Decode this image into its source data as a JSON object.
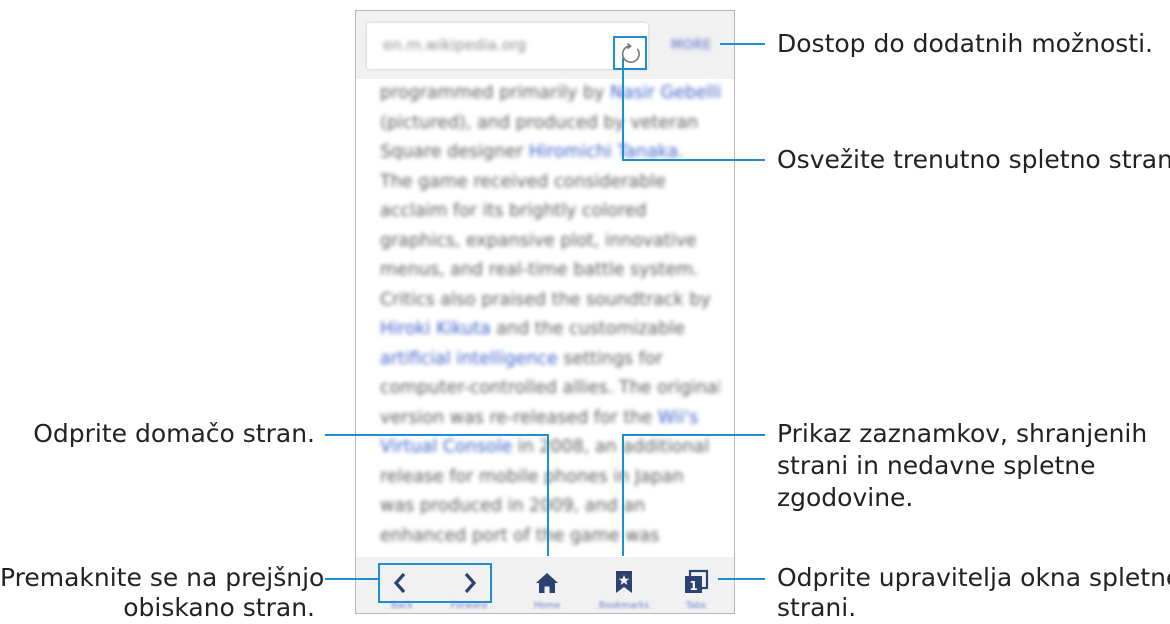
{
  "browser": {
    "url": "en.m.wikipedia.org",
    "more_label": "MORE",
    "content_lines": [
      [
        {
          "t": "programmed primarily by "
        },
        {
          "t": "Nasir Gebelli",
          "link": true
        }
      ],
      [
        {
          "t": "(pictured), and produced by veteran"
        }
      ],
      [
        {
          "t": "Square designer "
        },
        {
          "t": "Hiromichi Tanaka",
          "link": true
        },
        {
          "t": "."
        }
      ],
      [
        {
          "t": "The game received considerable"
        }
      ],
      [
        {
          "t": "acclaim for its brightly colored"
        }
      ],
      [
        {
          "t": "graphics, expansive plot, innovative"
        }
      ],
      [
        {
          "t": "menus, and real-time battle system."
        }
      ],
      [
        {
          "t": "Critics also praised the soundtrack by"
        }
      ],
      [
        {
          "t": "Hiroki Kikuta",
          "link": true
        },
        {
          "t": " and the customizable"
        }
      ],
      [
        {
          "t": "artificial intelligence",
          "link": true
        },
        {
          "t": " settings for"
        }
      ],
      [
        {
          "t": "computer-controlled allies. The original"
        }
      ],
      [
        {
          "t": "version was re-released for the "
        },
        {
          "t": "Wii's",
          "link": true
        }
      ],
      [
        {
          "t": "Virtual Console",
          "link": true
        },
        {
          "t": " in 2008, an additional"
        }
      ],
      [
        {
          "t": "release for mobile phones in Japan"
        }
      ],
      [
        {
          "t": "was produced in 2009, and an"
        }
      ],
      [
        {
          "t": "enhanced port of the game was"
        }
      ]
    ],
    "toolbar": {
      "back_label": "Back",
      "forward_label": "Forward",
      "home_label": "Home",
      "bookmarks_label": "Bookmarks",
      "tabs_label": "Tabs",
      "tab_count": "1"
    },
    "icons": {
      "refresh": "refresh-icon",
      "back": "chevron-left-icon",
      "forward": "chevron-right-icon",
      "home": "home-icon",
      "bookmarks": "bookmark-star-icon",
      "tabs": "tabs-icon"
    }
  },
  "annotations": {
    "more": "Dostop do dodatnih možnosti.",
    "refresh": "Osvežite trenutno spletno stran.",
    "home": "Odprite domačo stran.",
    "bookmarks_line1": "Prikaz zaznamkov, shranjenih",
    "bookmarks_line2": "strani in nedavne spletne",
    "bookmarks_line3": "zgodovine.",
    "back_line1": "Premaknite se na prejšnjo",
    "back_line2": "obiskano stran.",
    "tabs_line1": "Odprite upravitelja okna spletne",
    "tabs_line2": "strani."
  },
  "colors": {
    "accent": "#1f8ed1",
    "link": "#3e63c9",
    "toolbar_icon": "#2c4270"
  }
}
